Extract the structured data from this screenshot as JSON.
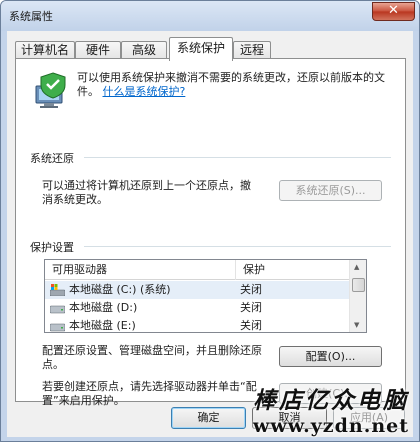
{
  "window": {
    "title": "系统属性",
    "close_glyph": "✕"
  },
  "tabs": [
    {
      "label": "计算机名"
    },
    {
      "label": "硬件"
    },
    {
      "label": "高级"
    },
    {
      "label": "系统保护",
      "active": true
    },
    {
      "label": "远程"
    }
  ],
  "intro": {
    "text": "可以使用系统保护来撤消不需要的系统更改，还原以前版本的文件。",
    "link": "什么是系统保护?",
    "icon": "system-protection-computer-icon"
  },
  "restore": {
    "title": "系统还原",
    "text": "可以通过将计算机还原到上一个还原点，撤消系统更改。",
    "button": "系统还原(S)..."
  },
  "protection": {
    "title": "保护设置",
    "columns": [
      "可用驱动器",
      "保护"
    ],
    "rows": [
      {
        "name": "本地磁盘 (C:) (系统)",
        "status": "关闭",
        "icon": "system-drive-icon"
      },
      {
        "name": "本地磁盘 (D:)",
        "status": "关闭",
        "icon": "hard-drive-icon"
      },
      {
        "name": "本地磁盘 (E:)",
        "status": "关闭",
        "icon": "hard-drive-icon"
      }
    ],
    "config_text": "配置还原设置、管理磁盘空间，并且删除还原点。",
    "config_button": "配置(O)...",
    "create_text": "若要创建还原点，请先选择驱动器并单击“配置”来启用保护。",
    "create_button": "创建(C)..."
  },
  "footer": {
    "ok": "确定",
    "cancel": "取消",
    "apply": "应用(A)"
  },
  "watermark": {
    "top": "棒店亿众电脑",
    "bottom": "www.yzdn.net"
  },
  "colors": {
    "link": "#0066cc",
    "frame": "#c4d4ea",
    "selection": "#e5eef8"
  }
}
